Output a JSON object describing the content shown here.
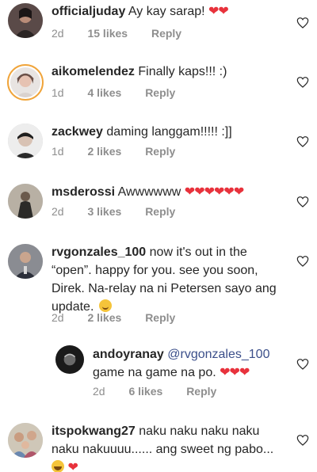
{
  "comments": [
    {
      "username": "officialjuday",
      "text": "Ay kay sarap!",
      "hearts": "❤❤",
      "time": "2d",
      "likes": "15 likes",
      "reply": "Reply"
    },
    {
      "username": "aikomelendez",
      "text": "Finally kaps!!! :)",
      "time": "1d",
      "likes": "4 likes",
      "reply": "Reply"
    },
    {
      "username": "zackwey",
      "text": "daming langgam!!!!! :]]",
      "time": "1d",
      "likes": "2 likes",
      "reply": "Reply"
    },
    {
      "username": "msderossi",
      "text": "Awwwwww",
      "hearts": "❤❤❤❤❤❤",
      "time": "2d",
      "likes": "3 likes",
      "reply": "Reply"
    },
    {
      "username": "rvgonzales_100",
      "text_line1": "now it's out in the",
      "text_line2": "“open”. happy for you. see you soon,",
      "text_line3": "Direk. Na-relay na ni Petersen sayo ang",
      "text_line4": "update.",
      "time": "2d",
      "likes": "2 likes",
      "reply": "Reply"
    },
    {
      "username": "andoyranay",
      "mention": "@rvgonzales_100",
      "text_line2": "game na game na po.",
      "hearts": "❤❤❤",
      "time": "2d",
      "likes": "6 likes",
      "reply": "Reply"
    },
    {
      "username": "itspokwang27",
      "text_line1": "naku naku naku naku",
      "text_line2": "naku nakuuuu...... ang sweet ng pabo...",
      "hearts": "❤"
    }
  ],
  "colors": {
    "like_heart": "#e8323c",
    "meta": "#8e8e8e",
    "text": "#262626"
  }
}
